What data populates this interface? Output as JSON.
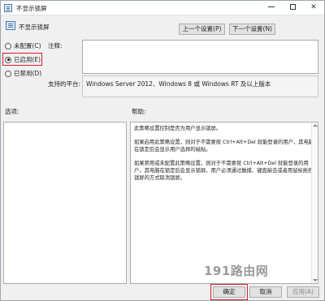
{
  "window": {
    "title": "不显示锁屏",
    "controls": {
      "minimize": "minimize-icon",
      "maximize": "maximize-icon",
      "close": "close-icon"
    }
  },
  "header": {
    "setting_name": "不显示锁屏",
    "prev_button": "上一个设置(P)",
    "next_button": "下一个设置(N)"
  },
  "state_options": [
    {
      "label": "未配置(C)",
      "selected": false
    },
    {
      "label": "已启用(E)",
      "selected": true
    },
    {
      "label": "已禁用(D)",
      "selected": false
    }
  ],
  "comment": {
    "label": "注释:",
    "value": ""
  },
  "supported_on": {
    "label": "支持的平台:",
    "value": "Windows Server 2012、Windows 8 或 Windows RT 及以上版本"
  },
  "options_label": "选项:",
  "help_label": "帮助:",
  "help_text": [
    "此策略设置控制是否为用户显示锁屏。",
    "如果启用此策略设置，则对于不需要按 Ctrl+Alt+Del 就能登录的用户，其电脑在锁定后会显示用户选择的磁贴。",
    "如果禁用或未配置此策略设置，则对于不需要按 Ctrl+Alt+Del 就能登录的用户，其电脑在锁定后会显示锁屏。用户必须通过触摸、键盘敲击或者用鼠标拖拽锁屏的方式取消锁屏。"
  ],
  "watermark": "191路由网",
  "footer": {
    "ok": "确定",
    "cancel": "取消",
    "apply": "应用(A)"
  },
  "colors": {
    "highlight": "#d2202a",
    "window_bg": "#f0f0f0"
  }
}
